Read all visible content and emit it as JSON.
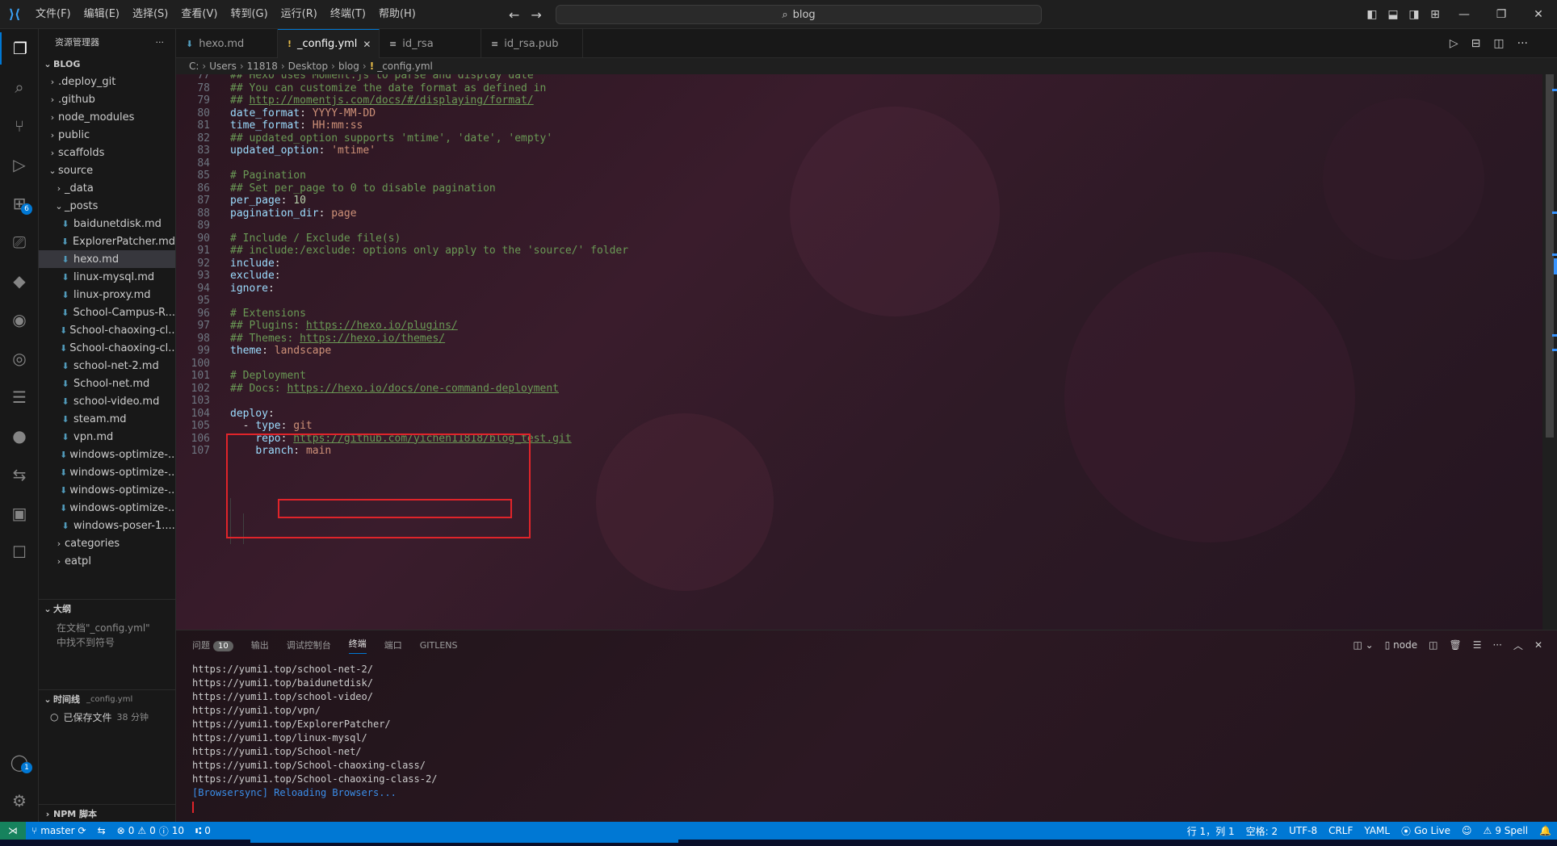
{
  "titlebar": {
    "menu": [
      "文件(F)",
      "编辑(E)",
      "选择(S)",
      "查看(V)",
      "转到(G)",
      "运行(R)",
      "终端(T)",
      "帮助(H)"
    ],
    "search_text": "blog"
  },
  "activity_bar": {
    "extensions_badge": "6",
    "accounts_badge": "1"
  },
  "sidebar": {
    "header": "资源管理器",
    "more": "···",
    "folder_title": "BLOG",
    "tree": [
      {
        "label": ".deploy_git",
        "type": "folder",
        "depth": 0,
        "open": false
      },
      {
        "label": ".github",
        "type": "folder",
        "depth": 0,
        "open": false
      },
      {
        "label": "node_modules",
        "type": "folder",
        "depth": 0,
        "open": false
      },
      {
        "label": "public",
        "type": "folder",
        "depth": 0,
        "open": false
      },
      {
        "label": "scaffolds",
        "type": "folder",
        "depth": 0,
        "open": false
      },
      {
        "label": "source",
        "type": "folder",
        "depth": 0,
        "open": true
      },
      {
        "label": "_data",
        "type": "folder",
        "depth": 1,
        "open": false
      },
      {
        "label": "_posts",
        "type": "folder",
        "depth": 1,
        "open": true
      },
      {
        "label": "baidunetdisk.md",
        "type": "file",
        "depth": 2
      },
      {
        "label": "ExplorerPatcher.md",
        "type": "file",
        "depth": 2
      },
      {
        "label": "hexo.md",
        "type": "file",
        "depth": 2,
        "selected": true
      },
      {
        "label": "linux-mysql.md",
        "type": "file",
        "depth": 2
      },
      {
        "label": "linux-proxy.md",
        "type": "file",
        "depth": 2
      },
      {
        "label": "School-Campus-R...",
        "type": "file",
        "depth": 2
      },
      {
        "label": "School-chaoxing-cl...",
        "type": "file",
        "depth": 2
      },
      {
        "label": "School-chaoxing-cl...",
        "type": "file",
        "depth": 2
      },
      {
        "label": "school-net-2.md",
        "type": "file",
        "depth": 2
      },
      {
        "label": "School-net.md",
        "type": "file",
        "depth": 2
      },
      {
        "label": "school-video.md",
        "type": "file",
        "depth": 2
      },
      {
        "label": "steam.md",
        "type": "file",
        "depth": 2
      },
      {
        "label": "vpn.md",
        "type": "file",
        "depth": 2
      },
      {
        "label": "windows-optimize-...",
        "type": "file",
        "depth": 2
      },
      {
        "label": "windows-optimize-...",
        "type": "file",
        "depth": 2
      },
      {
        "label": "windows-optimize-...",
        "type": "file",
        "depth": 2
      },
      {
        "label": "windows-optimize-...",
        "type": "file",
        "depth": 2
      },
      {
        "label": "windows-poser-1....",
        "type": "file",
        "depth": 2
      },
      {
        "label": "categories",
        "type": "folder",
        "depth": 1,
        "open": false
      },
      {
        "label": "eatpl",
        "type": "folder",
        "depth": 1,
        "open": false
      }
    ],
    "outline_title": "大纲",
    "outline_empty_line1": "在文档\"_config.yml\"",
    "outline_empty_line2": "中找不到符号",
    "timeline_title": "时间线",
    "timeline_file": "_config.yml",
    "timeline_entry": "已保存文件",
    "timeline_time": "38 分钟",
    "npm_title": "NPM 脚本"
  },
  "tabs": [
    {
      "label": "hexo.md",
      "icon": "markdown-icon",
      "active": false,
      "dirty": false
    },
    {
      "label": "_config.yml",
      "icon": "yaml-icon",
      "active": true,
      "dirty": false
    },
    {
      "label": "id_rsa",
      "icon": "file-icon",
      "active": false,
      "dirty": false
    },
    {
      "label": "id_rsa.pub",
      "icon": "file-icon",
      "active": false,
      "dirty": false
    }
  ],
  "breadcrumb": [
    "C:",
    "Users",
    "11818",
    "Desktop",
    "blog",
    "_config.yml"
  ],
  "editor": {
    "lines": [
      {
        "n": "77",
        "parts": [
          [
            "c-comment",
            "## Hexo uses Moment.js to parse and display date"
          ]
        ]
      },
      {
        "n": "78",
        "parts": [
          [
            "c-comment",
            "## You can customize the date format as defined in"
          ]
        ]
      },
      {
        "n": "79",
        "parts": [
          [
            "c-comment",
            "## "
          ],
          [
            "c-link",
            "http://momentjs.com/docs/#/displaying/format/"
          ]
        ]
      },
      {
        "n": "80",
        "parts": [
          [
            "c-key",
            "date_format"
          ],
          [
            "c-white",
            ": "
          ],
          [
            "c-val",
            "YYYY-MM-DD"
          ]
        ]
      },
      {
        "n": "81",
        "parts": [
          [
            "c-key",
            "time_format"
          ],
          [
            "c-white",
            ": "
          ],
          [
            "c-val",
            "HH:mm:ss"
          ]
        ]
      },
      {
        "n": "82",
        "parts": [
          [
            "c-comment",
            "## updated_option supports 'mtime', 'date', 'empty'"
          ]
        ]
      },
      {
        "n": "83",
        "parts": [
          [
            "c-key",
            "updated_option"
          ],
          [
            "c-white",
            ": "
          ],
          [
            "c-val",
            "'mtime'"
          ]
        ]
      },
      {
        "n": "84",
        "parts": []
      },
      {
        "n": "85",
        "parts": [
          [
            "c-comment",
            "# Pagination"
          ]
        ]
      },
      {
        "n": "86",
        "parts": [
          [
            "c-comment",
            "## Set per_page to 0 to disable pagination"
          ]
        ]
      },
      {
        "n": "87",
        "parts": [
          [
            "c-key",
            "per_page"
          ],
          [
            "c-white",
            ": "
          ],
          [
            "c-num",
            "10"
          ]
        ]
      },
      {
        "n": "88",
        "parts": [
          [
            "c-key",
            "pagination_dir"
          ],
          [
            "c-white",
            ": "
          ],
          [
            "c-val",
            "page"
          ]
        ]
      },
      {
        "n": "89",
        "parts": []
      },
      {
        "n": "90",
        "parts": [
          [
            "c-comment",
            "# Include / Exclude file(s)"
          ]
        ]
      },
      {
        "n": "91",
        "parts": [
          [
            "c-comment",
            "## include:/exclude: options only apply to the 'source/' folder"
          ]
        ]
      },
      {
        "n": "92",
        "parts": [
          [
            "c-key",
            "include"
          ],
          [
            "c-white",
            ":"
          ]
        ]
      },
      {
        "n": "93",
        "parts": [
          [
            "c-key",
            "exclude"
          ],
          [
            "c-white",
            ":"
          ]
        ]
      },
      {
        "n": "94",
        "parts": [
          [
            "c-key",
            "ignore"
          ],
          [
            "c-white",
            ":"
          ]
        ]
      },
      {
        "n": "95",
        "parts": []
      },
      {
        "n": "96",
        "parts": [
          [
            "c-comment",
            "# Extensions"
          ]
        ]
      },
      {
        "n": "97",
        "parts": [
          [
            "c-comment",
            "## Plugins: "
          ],
          [
            "c-link",
            "https://hexo.io/plugins/"
          ]
        ]
      },
      {
        "n": "98",
        "parts": [
          [
            "c-comment",
            "## Themes: "
          ],
          [
            "c-link",
            "https://hexo.io/themes/"
          ]
        ]
      },
      {
        "n": "99",
        "parts": [
          [
            "c-key",
            "theme"
          ],
          [
            "c-white",
            ": "
          ],
          [
            "c-val",
            "landscape"
          ]
        ]
      },
      {
        "n": "100",
        "parts": []
      },
      {
        "n": "101",
        "parts": [
          [
            "c-comment",
            "# Deployment"
          ]
        ]
      },
      {
        "n": "102",
        "parts": [
          [
            "c-comment",
            "## Docs: "
          ],
          [
            "c-link",
            "https://hexo.io/docs/one-command-deployment"
          ]
        ]
      },
      {
        "n": "103",
        "parts": []
      },
      {
        "n": "104",
        "parts": [
          [
            "c-key",
            "deploy"
          ],
          [
            "c-white",
            ":"
          ]
        ]
      },
      {
        "n": "105",
        "parts": [
          [
            "c-white",
            "  - "
          ],
          [
            "c-key",
            "type"
          ],
          [
            "c-white",
            ": "
          ],
          [
            "c-val",
            "git"
          ]
        ]
      },
      {
        "n": "106",
        "parts": [
          [
            "c-white",
            "    "
          ],
          [
            "c-key",
            "repo"
          ],
          [
            "c-white",
            ": "
          ],
          [
            "c-link",
            "https://github.com/yichen11818/blog_test.git"
          ]
        ]
      },
      {
        "n": "107",
        "parts": [
          [
            "c-white",
            "    "
          ],
          [
            "c-key",
            "branch"
          ],
          [
            "c-white",
            ": "
          ],
          [
            "c-val",
            "main"
          ]
        ]
      }
    ]
  },
  "panel": {
    "tabs": [
      "问题",
      "输出",
      "调试控制台",
      "终端",
      "端口",
      "GITLENS"
    ],
    "problems_count": "10",
    "active_tab": "终端",
    "terminal_name": "node",
    "terminal_lines": [
      "https://yumi1.top/school-net-2/",
      "https://yumi1.top/baidunetdisk/",
      "https://yumi1.top/school-video/",
      "https://yumi1.top/vpn/",
      "https://yumi1.top/ExplorerPatcher/",
      "https://yumi1.top/linux-mysql/",
      "https://yumi1.top/School-net/",
      "https://yumi1.top/School-chaoxing-class/",
      "https://yumi1.top/School-chaoxing-class-2/"
    ],
    "browsersync_tag": "[Browsersync]",
    "browsersync_msg": " Reloading Browsers..."
  },
  "statusbar": {
    "branch": "master",
    "errors": "0",
    "warnings": "0",
    "infos": "10",
    "ports": "0",
    "position": "行 1，列 1",
    "spaces": "空格: 2",
    "encoding": "UTF-8",
    "eol": "CRLF",
    "language": "YAML",
    "golive": "Go Live",
    "spell": "9 Spell"
  },
  "colors": {
    "accent": "#0078d4",
    "highlight_box": "#e0242a"
  }
}
